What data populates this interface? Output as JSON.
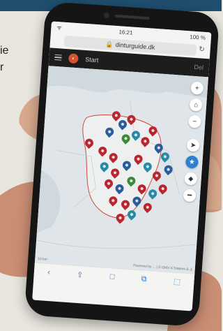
{
  "background": {
    "text_line1": "ie",
    "text_line2": "r"
  },
  "phone": {
    "status": {
      "time": "16:21",
      "signal_left": "ᯤ",
      "battery": "100 %"
    },
    "browser": {
      "url": "dinturguide.dk",
      "reload_icon": "reload-icon",
      "lock_icon": "lock-icon"
    },
    "app": {
      "title": "Start",
      "right": "Del"
    },
    "map": {
      "controls": [
        "+",
        "⌂",
        "−",
        "➤",
        "★",
        "⬥",
        "━"
      ],
      "attribution_left": "10 km",
      "attribution_right": "Powered by ... | © GMV A Statens & Jj"
    },
    "toolbar": [
      "‹",
      "⇪",
      "□",
      "⧉",
      "⬚"
    ]
  },
  "colors": {
    "accent": "#d9502b",
    "banner": "#1f4e6e",
    "pin_red": "#b8262f",
    "pin_blue": "#2a5d9a",
    "pin_teal": "#2a8aa5",
    "pin_green": "#3a8a3a"
  }
}
